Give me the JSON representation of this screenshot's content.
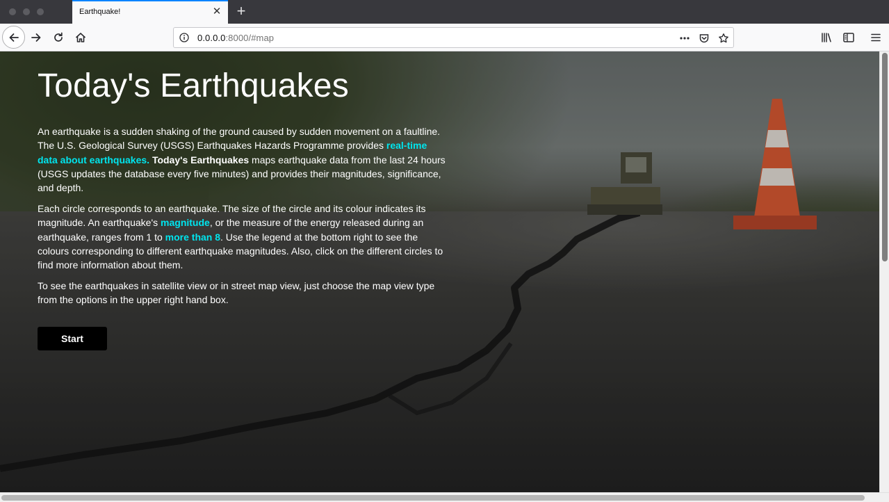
{
  "browser": {
    "tab_title": "Earthquake!",
    "tab_close": "✕",
    "new_tab": "+",
    "url_host": "0.0.0.0",
    "url_rest": ":8000/#map"
  },
  "page": {
    "title": "Today's Earthquakes",
    "p1": {
      "t1": "An earthquake is a sudden shaking of the ground caused by sudden movement on a faultline. The U.S. Geological Survey (USGS) Earthquakes Hazards Programme provides ",
      "link": "real-time data about earthquakes",
      "t2": ". ",
      "strong": "Today's Earthquakes",
      "t3": " maps earthquake data from the last 24 hours (USGS updates the database every five minutes) and provides their magnitudes, significance, and depth."
    },
    "p2": {
      "t1": "Each circle corresponds to an earthquake. The size of the circle and its colour indicates its magnitude. An earthquake's ",
      "link1": "magnitude",
      "t2": ", or the measure of the energy released during an earthquake, ranges from 1 to ",
      "link2": "more than 8",
      "t3": ". Use the legend at the bottom right to see the colours corresponding to different earthquake magnitudes. Also, click on the different circles to find more information about them."
    },
    "p3": "To see the earthquakes in satellite view or in street map view, just choose the map view type from the options in the upper right hand box.",
    "start_label": "Start"
  },
  "colors": {
    "link": "#00e5ee",
    "button_bg": "#000000",
    "tab_accent": "#0a84ff"
  },
  "icons": [
    "back-icon",
    "forward-icon",
    "reload-icon",
    "home-icon",
    "info-icon",
    "more-icon",
    "pocket-icon",
    "star-icon",
    "library-icon",
    "sidebar-icon",
    "menu-icon",
    "close-icon",
    "plus-icon"
  ]
}
